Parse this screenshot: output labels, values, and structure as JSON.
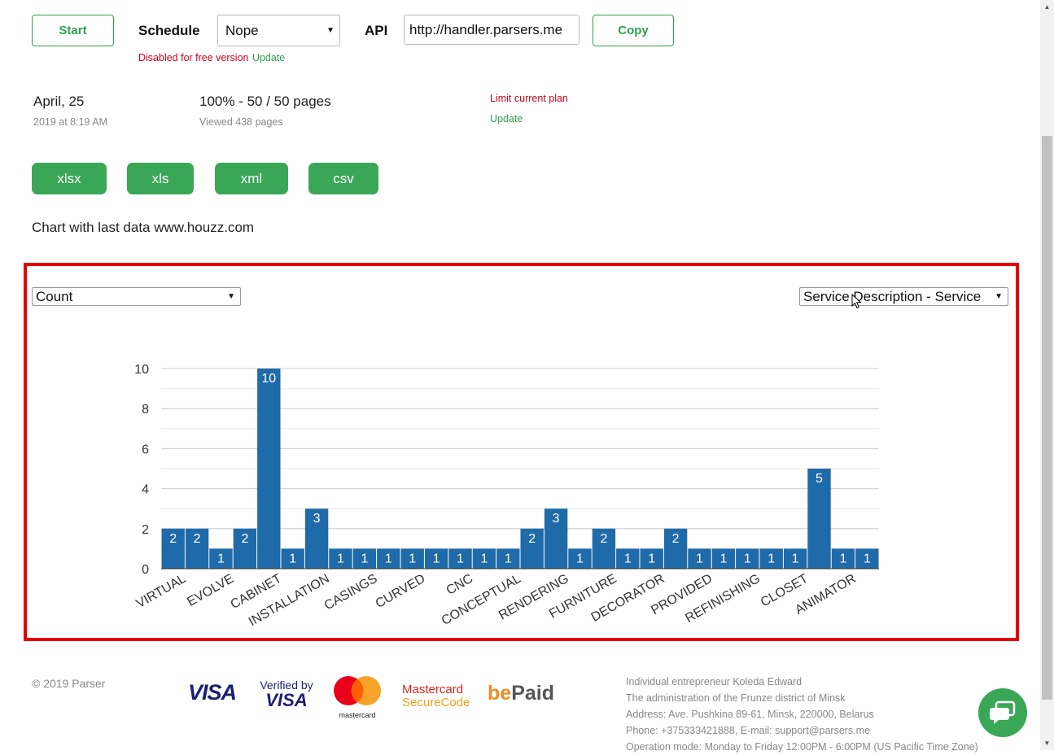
{
  "toolbar": {
    "start_label": "Start",
    "schedule_label": "Schedule",
    "schedule_value": "Nope",
    "disabled_note": "Disabled for free version",
    "update_link": "Update",
    "api_label": "API",
    "api_value": "http://handler.parsers.me",
    "copy_label": "Copy"
  },
  "status": {
    "date": "April, 25",
    "date_sub": "2019 at 8:19 AM",
    "progress": "100% - 50 / 50 pages",
    "viewed": "Viewed 438 pages",
    "limit_text": "Limit current plan",
    "update_link": "Update"
  },
  "exports": [
    "xlsx",
    "xls",
    "xml",
    "csv"
  ],
  "chart_heading": "Chart with last data www.houzz.com",
  "chart_controls": {
    "metric_value": "Count",
    "field_value": "Service Description - Service"
  },
  "chart_data": {
    "type": "bar",
    "categories": [
      "VIRTUAL",
      "",
      "EVOLVE",
      "",
      "CABINET",
      "",
      "INSTALLATION",
      "",
      "CASINGS",
      "",
      "CURVED",
      "",
      "CNC",
      "",
      "CONCEPTUAL",
      "",
      "RENDERING",
      "",
      "FURNITURE",
      "",
      "DECORATOR",
      "",
      "PROVIDED",
      "",
      "REFINISHING",
      "",
      "CLOSET",
      "",
      "ANIMATOR",
      ""
    ],
    "values": [
      2,
      2,
      1,
      2,
      10,
      1,
      3,
      1,
      1,
      1,
      1,
      1,
      1,
      1,
      1,
      2,
      3,
      1,
      2,
      1,
      1,
      2,
      1,
      1,
      1,
      1,
      1,
      5,
      1,
      1
    ],
    "ylim": [
      0,
      10
    ],
    "yticks": [
      0,
      2,
      4,
      6,
      8,
      10
    ],
    "grid": true,
    "bar_color": "#1f6aa8"
  },
  "footer": {
    "copyright": "© 2019 Parser",
    "logos": {
      "visa": "VISA",
      "verified_by": "Verified by",
      "verified_visa": "VISA",
      "mastercard": "mastercard",
      "mc_secure_1": "Mastercard",
      "mc_secure_2": "SecureCode",
      "bepaid_be": "be",
      "bepaid_paid": "Paid"
    },
    "info": [
      "Individual entrepreneur Koleda Edward",
      "The administration of the Frunze district of Minsk",
      "Address: Ave. Pushkina 89-61, Minsk, 220000, Belarus",
      "Phone: +375333421888, E-mail: support@parsers.me",
      "Operation mode: Monday to Friday 12:00PM - 6:00PM (US Pacific Time Zone)"
    ]
  },
  "icons": {
    "chat": "chat-bubble-icon"
  },
  "colors": {
    "accent_green": "#3aa757",
    "danger_red": "#d0021b",
    "frame_red": "#e60000"
  }
}
